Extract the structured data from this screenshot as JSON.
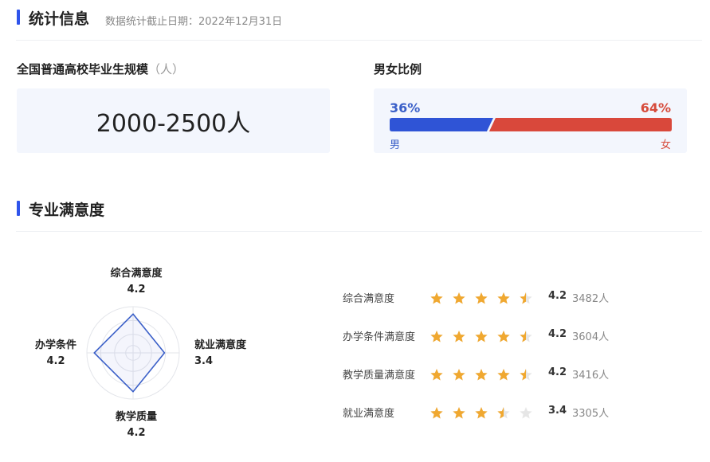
{
  "stats": {
    "title": "统计信息",
    "cutoff": "数据统计截止日期：2022年12月31日",
    "graduates_label": "全国普通高校毕业生规模",
    "graduates_unit": "（人）",
    "graduates_value": "2000-2500人",
    "gender_label": "男女比例",
    "male_pct_text": "36%",
    "female_pct_text": "64%",
    "male_fraction": 0.36,
    "male_label": "男",
    "female_label": "女",
    "colors": {
      "male": "#2f54d6",
      "female": "#d9483b",
      "accent": "#2f54eb"
    }
  },
  "satisfaction": {
    "title": "专业满意度",
    "radar": {
      "max": 5,
      "axes": [
        {
          "name": "综合满意度",
          "value": 4.2,
          "value_text": "4.2"
        },
        {
          "name": "就业满意度",
          "value": 3.4,
          "value_text": "3.4"
        },
        {
          "name": "教学质量",
          "value": 4.2,
          "value_text": "4.2"
        },
        {
          "name": "办学条件",
          "value": 4.2,
          "value_text": "4.2"
        }
      ]
    },
    "ratings": [
      {
        "name": "综合满意度",
        "score": 4.2,
        "score_text": "4.2",
        "count": "3482人"
      },
      {
        "name": "办学条件满意度",
        "score": 4.2,
        "score_text": "4.2",
        "count": "3604人"
      },
      {
        "name": "教学质量满意度",
        "score": 4.2,
        "score_text": "4.2",
        "count": "3416人"
      },
      {
        "name": "就业满意度",
        "score": 3.4,
        "score_text": "3.4",
        "count": "3305人"
      }
    ],
    "star_color": "#f0a830",
    "star_empty_color": "#e6e6e6"
  }
}
